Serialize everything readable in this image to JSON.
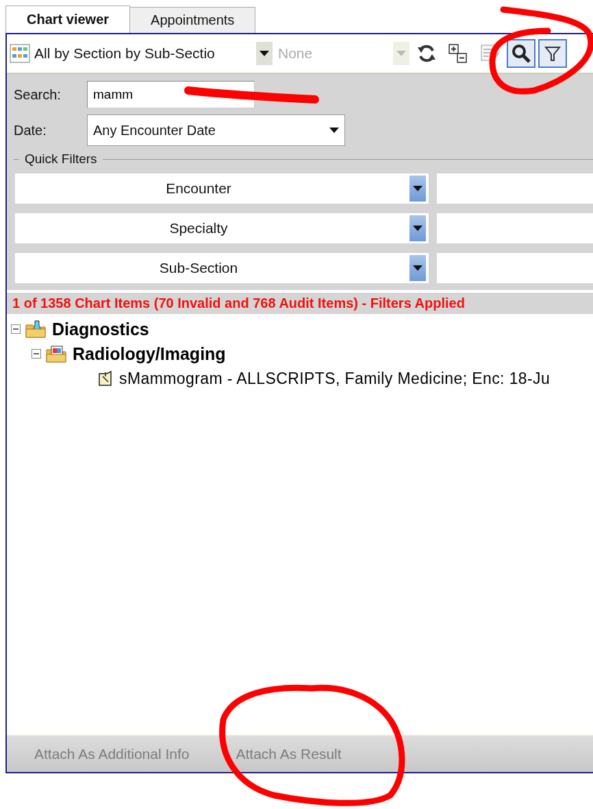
{
  "tabs": [
    {
      "label": "Chart viewer",
      "selected": true
    },
    {
      "label": "Appointments",
      "selected": false
    }
  ],
  "toolbar": {
    "view_select": {
      "value": "All by Section by Sub-Sectio"
    },
    "group_select": {
      "value": "None",
      "disabled": true
    },
    "tools": [
      {
        "kind": "refresh",
        "pressed": false,
        "disabled": false
      },
      {
        "kind": "expand-collapse",
        "pressed": false,
        "disabled": false
      },
      {
        "kind": "edit",
        "pressed": false,
        "disabled": true
      },
      {
        "kind": "search",
        "pressed": true,
        "disabled": false
      },
      {
        "kind": "filter",
        "pressed": true,
        "disabled": false
      }
    ]
  },
  "search": {
    "label": "Search:",
    "value": "mamm"
  },
  "date": {
    "label": "Date:",
    "value": "Any Encounter Date"
  },
  "quick_filters": {
    "title": "Quick Filters",
    "filters": [
      {
        "label": "Encounter"
      },
      {
        "label": "Specialty"
      },
      {
        "label": "Sub-Section"
      }
    ]
  },
  "status": "1 of 1358 Chart Items (70 Invalid and 768 Audit Items) - Filters Applied",
  "tree": [
    {
      "label": "Diagnostics",
      "kind": "lab-folder",
      "expanded": true,
      "children": [
        {
          "label": "Radiology/Imaging",
          "kind": "imaging-folder",
          "expanded": true,
          "children": [
            {
              "label": "sMammogram - ALLSCRIPTS, Family Medicine; Enc: 18-Ju",
              "kind": "document"
            }
          ]
        }
      ]
    }
  ],
  "buttons": [
    {
      "label": "Attach As Additional Info",
      "disabled": true
    },
    {
      "label": "Attach As Result",
      "disabled": true
    }
  ]
}
